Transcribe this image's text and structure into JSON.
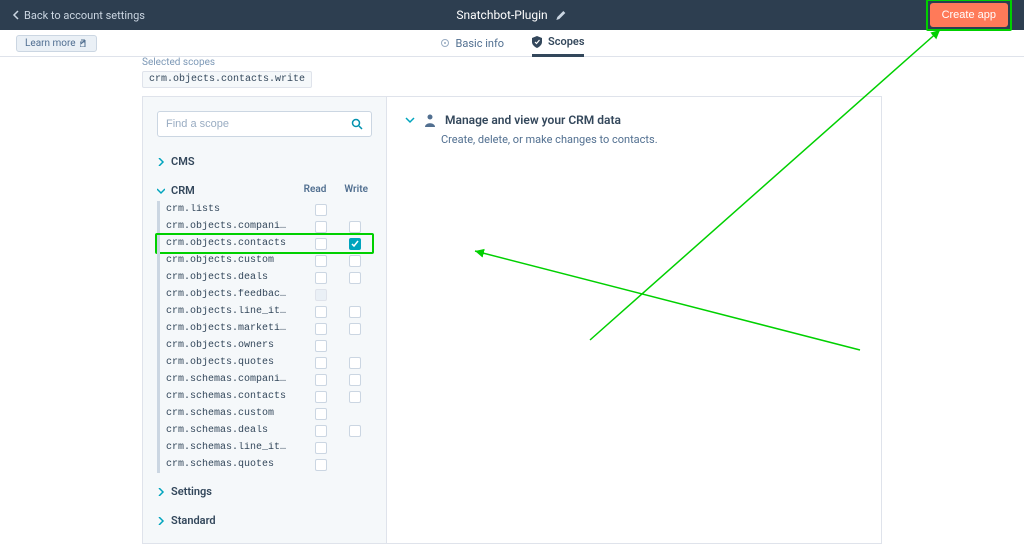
{
  "topbar": {
    "back_label": "Back to account settings",
    "app_title": "Snatchbot-Plugin",
    "create_label": "Create app"
  },
  "tabs": {
    "learnmore": "Learn more",
    "basic_info": "Basic info",
    "scopes": "Scopes"
  },
  "selected_section": {
    "heading": "Selected scopes",
    "code": "crm.objects.contacts.write"
  },
  "search": {
    "placeholder": "Find a scope"
  },
  "columns": {
    "read": "Read",
    "write": "Write"
  },
  "categories": {
    "cms": {
      "label": "CMS",
      "expanded": false
    },
    "crm": {
      "label": "CRM",
      "expanded": true,
      "rows": [
        {
          "name": "crm.lists",
          "read": "unchecked",
          "write": null
        },
        {
          "name": "crm.objects.compani…",
          "read": "unchecked",
          "write": "unchecked"
        },
        {
          "name": "crm.objects.contacts",
          "read": "unchecked",
          "write": "checked",
          "highlight": true
        },
        {
          "name": "crm.objects.custom",
          "read": "unchecked",
          "write": "unchecked"
        },
        {
          "name": "crm.objects.deals",
          "read": "unchecked",
          "write": "unchecked"
        },
        {
          "name": "crm.objects.feedbac…",
          "read": "disabled",
          "write": null
        },
        {
          "name": "crm.objects.line_it…",
          "read": "unchecked",
          "write": "unchecked"
        },
        {
          "name": "crm.objects.marketi…",
          "read": "unchecked",
          "write": "unchecked"
        },
        {
          "name": "crm.objects.owners",
          "read": "unchecked",
          "write": null
        },
        {
          "name": "crm.objects.quotes",
          "read": "unchecked",
          "write": "unchecked"
        },
        {
          "name": "crm.schemas.compani…",
          "read": "unchecked",
          "write": "unchecked"
        },
        {
          "name": "crm.schemas.contacts",
          "read": "unchecked",
          "write": "unchecked"
        },
        {
          "name": "crm.schemas.custom",
          "read": "unchecked",
          "write": null
        },
        {
          "name": "crm.schemas.deals",
          "read": "unchecked",
          "write": "unchecked"
        },
        {
          "name": "crm.schemas.line_it…",
          "read": "unchecked",
          "write": null
        },
        {
          "name": "crm.schemas.quotes",
          "read": "unchecked",
          "write": null
        }
      ]
    },
    "settings": {
      "label": "Settings",
      "expanded": false
    },
    "standard": {
      "label": "Standard",
      "expanded": false
    }
  },
  "detail": {
    "title": "Manage and view your CRM data",
    "desc": "Create, delete, or make changes to contacts."
  },
  "colors": {
    "accent": "#ff7a59",
    "check": "#00a4bd",
    "highlight": "#00d000"
  }
}
